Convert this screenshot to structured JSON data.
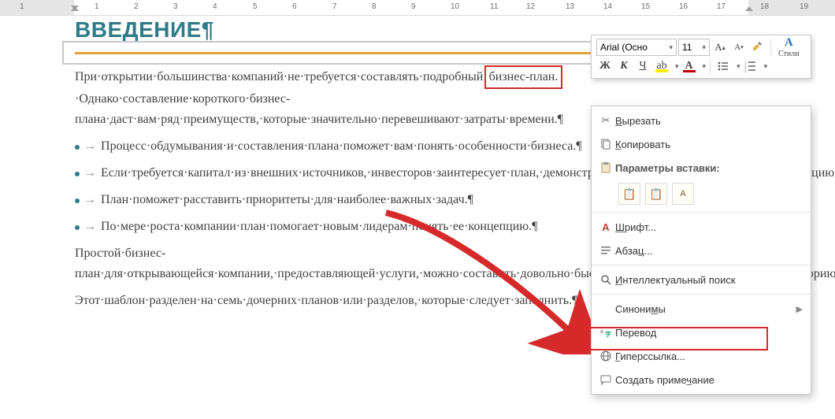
{
  "ruler": {
    "labels": [
      "1",
      "1",
      "2",
      "3",
      "4",
      "5",
      "6",
      "7",
      "8",
      "9",
      "10",
      "11",
      "12",
      "13",
      "14",
      "15",
      "16",
      "17",
      "18",
      "19"
    ]
  },
  "doc": {
    "title": "ВВЕДЕНИЕ¶",
    "p1": "При·открытии·большинства·компаний·не·требуется·составлять·подробный·",
    "p1_hl": "бизнес-план.",
    "p1b": "·Однако·составление·короткого·бизнес-плана·даст·вам·ряд·преимуществ,·которые·значительно·перевешивают·затраты·времени.¶",
    "b1": "Процесс·обдумывания·и·составления·плана·поможет·вам·понять·особенности·бизнеса.¶",
    "b2": "Если·требуется·капитал·из·внешних·источников,·инвесторов·заинтересует·план,·демонстрирующий·хорошее·понимание·и·концепцию·бизнеса.¶",
    "b3": "План·поможет·расставить·приоритеты·для·наиболее·важных·задач.¶",
    "b4": "По·мере·роста·компании·план·помогает·новым·лидерам·понять·ее·концепцию.¶",
    "p2": "Простой·бизнес-план·для·открывающейся·компании,·предоставляющей·услуги,·можно·составить·довольно·быстро.·Учитывайте·потенциальную·аудиторию·и·цель,·составляя·план.·Он·должен·быть·понятным,·удобочитаемым·и·реалистичным.¶",
    "p3": "Этот·шаблон·разделен·на·семь·дочерних·планов·или·разделов,·которые·следует·заполнить.¶"
  },
  "toolbar": {
    "font_name": "Arial (Осно",
    "font_size": "11",
    "styles_label": "Стили"
  },
  "ctx": {
    "cut": "Вырезать",
    "copy": "Копировать",
    "paste_header": "Параметры вставки:",
    "font": "Шрифт...",
    "para": "Абзац...",
    "smart": "Интеллектуальный поиск",
    "syn": "Синонимы",
    "trans": "Перевод",
    "hyper": "Гиперссылка...",
    "comment": "Создать примечание"
  }
}
